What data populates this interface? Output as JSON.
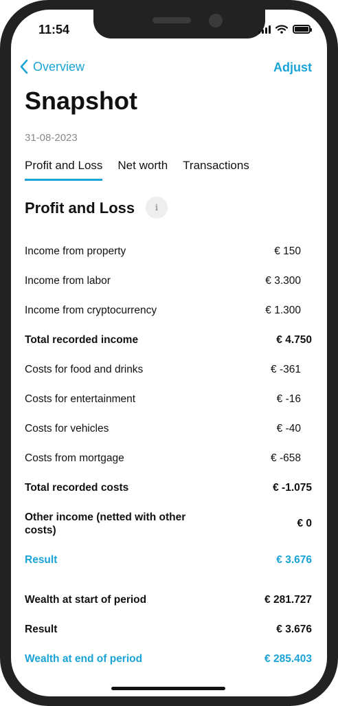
{
  "status_bar": {
    "time": "11:54"
  },
  "nav": {
    "back_label": "Overview",
    "action_label": "Adjust"
  },
  "header": {
    "title": "Snapshot",
    "date": "31-08-2023"
  },
  "tabs": [
    {
      "label": "Profit and Loss",
      "active": true
    },
    {
      "label": "Net worth",
      "active": false
    },
    {
      "label": "Transactions",
      "active": false
    }
  ],
  "section": {
    "title": "Profit and Loss",
    "info_glyph": "i"
  },
  "rows": [
    {
      "label": "Income from property",
      "amount": "€ 150",
      "style": "normal"
    },
    {
      "label": "Income from labor",
      "amount": "€ 3.300",
      "style": "normal"
    },
    {
      "label": "Income from cryptocurrency",
      "amount": "€ 1.300",
      "style": "normal"
    },
    {
      "label": "Total recorded income",
      "amount": "€ 4.750",
      "style": "bold"
    },
    {
      "label": "Costs for food and drinks",
      "amount": "€ -361",
      "style": "normal"
    },
    {
      "label": "Costs for entertainment",
      "amount": "€ -16",
      "style": "normal"
    },
    {
      "label": "Costs for vehicles",
      "amount": "€ -40",
      "style": "normal"
    },
    {
      "label": "Costs from mortgage",
      "amount": "€ -658",
      "style": "normal"
    },
    {
      "label": "Total recorded costs",
      "amount": "€ -1.075",
      "style": "bold"
    },
    {
      "label": "Other income (netted with other costs)",
      "amount": "€ 0",
      "style": "bold"
    },
    {
      "label": "Result",
      "amount": "€ 3.676",
      "style": "accent"
    },
    {
      "label": "Wealth at start of period",
      "amount": "€ 281.727",
      "style": "bold"
    },
    {
      "label": "Result",
      "amount": "€ 3.676",
      "style": "bold"
    },
    {
      "label": "Wealth at end of period",
      "amount": "€ 285.403",
      "style": "accent"
    }
  ],
  "colors": {
    "accent": "#1aa3d6",
    "text": "#111111",
    "muted": "#8a8a8a"
  },
  "icons": {
    "back": "chevron-left-icon",
    "info": "info-icon",
    "signal": "signal-icon",
    "wifi": "wifi-icon",
    "battery": "battery-icon"
  }
}
